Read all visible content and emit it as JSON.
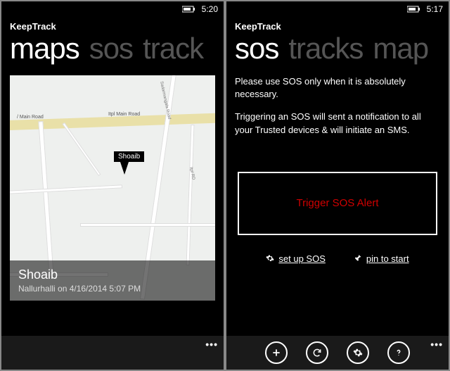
{
  "left": {
    "status_time": "5:20",
    "app_title": "KeepTrack",
    "pivot": {
      "active": "maps",
      "inactive1": "sos",
      "inactive2": "track"
    },
    "map": {
      "marker_name": "Shoaib",
      "road_label_left": "/ Main Road",
      "road_label_right": "Itpl Main Road",
      "vroad_label1": "Sadarmangala Road",
      "vroad_label2": "Itpl RD",
      "footer_name": "Shoaib",
      "footer_sub": "Nallurhalli on 4/16/2014 5:07 PM"
    }
  },
  "right": {
    "status_time": "5:17",
    "app_title": "KeepTrack",
    "pivot": {
      "active": "sos",
      "inactive1": "tracks",
      "inactive2": "map"
    },
    "para1": "Please use SOS only when it is absolutely necessary.",
    "para2": "Triggering an SOS will sent a notification to all your Trusted devices & will initiate an SMS.",
    "trigger_label": "Trigger SOS Alert",
    "link_setup": "set up SOS",
    "link_pin": "pin to start"
  }
}
